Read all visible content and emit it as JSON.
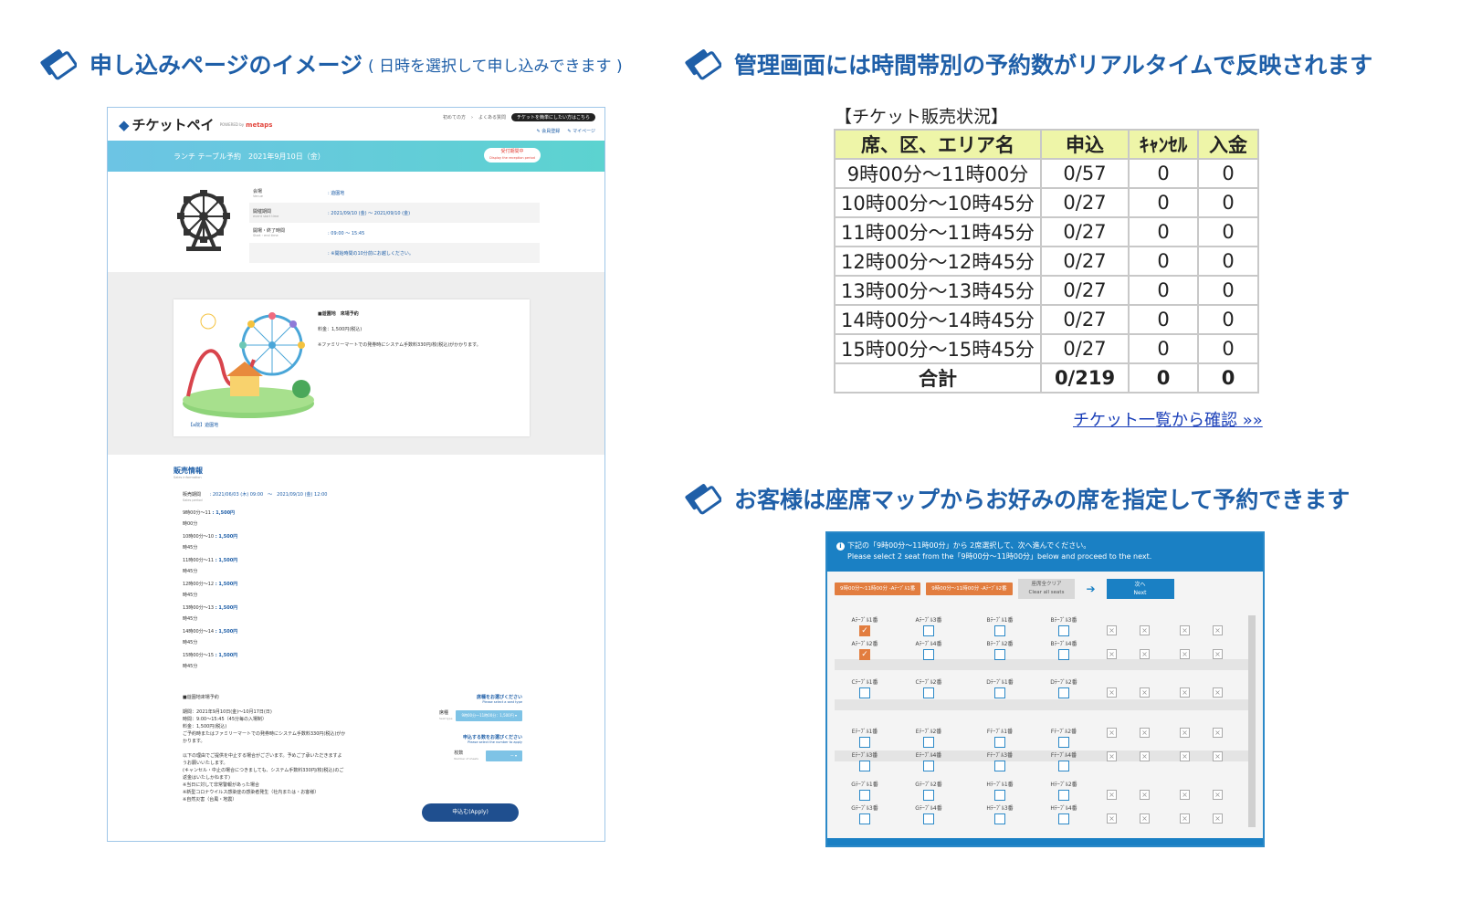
{
  "headings": {
    "left": {
      "main": "申し込みページのイメージ",
      "small": "( 日時を選択して申し込みできます )"
    },
    "right_top": "管理画面には時間帯別の予約数がリアルタイムで反映されます",
    "right_bottom": "お客様は座席マップからお好みの席を指定して予約できます"
  },
  "colors": {
    "heading": "#1f5fa8",
    "accent_orange": "#e27d3f",
    "accent_blue": "#1a80c4",
    "table_header": "#eef5a8"
  },
  "apply_page": {
    "logo": "チケットペイ",
    "logo_powered": "POWERED by",
    "logo_brand": "metaps",
    "links": [
      "初めての方",
      "よくある質問",
      "チケットを簡単にしたい方はこちら"
    ],
    "sublinks": [
      "会員登録",
      "マイページ"
    ],
    "event_title": "ランチ テーブル予約　2021年9月10日（金）",
    "status": "受付期間中",
    "status_en": "Display the reception period",
    "info": [
      {
        "label": "会場",
        "label_en": "Venue",
        "value": ": 遊園地"
      },
      {
        "label": "開催期間",
        "label_en": "event start time",
        "value": ": 2021/09/10 (金) 〜 2021/09/10 (金)"
      },
      {
        "label": "開場・終了時間",
        "label_en": "Start・end time",
        "value": ": 09:00 〜 15:45"
      },
      {
        "label": "",
        "label_en": "",
        "value": ": ※開始時間の10分前にお越しください。"
      }
    ],
    "card": {
      "title": "■遊園地　來場予約",
      "price": "料金：1,500円(税込)",
      "note": "※ファミリーマートでの発券時にシステム手数料330円/枚(税込)がかかります。",
      "tag": "【a院】遊園地"
    },
    "sales": {
      "title": "販売情報",
      "title_en": "Sales information",
      "period_label": "販売期間",
      "period_label_en": "Sales period",
      "period": ": 2021/06/03 (木) 09:00　〜　2021/09/10 (金) 12:00",
      "prices": [
        {
          "slot1": "9時00分〜11",
          "slot2": "時00分",
          "price": ": 1,500円"
        },
        {
          "slot1": "10時00分〜10",
          "slot2": "時45分",
          "price": ": 1,500円"
        },
        {
          "slot1": "11時00分〜11",
          "slot2": "時45分",
          "price": ": 1,500円"
        },
        {
          "slot1": "12時00分〜12",
          "slot2": "時45分",
          "price": ": 1,500円"
        },
        {
          "slot1": "13時00分〜13",
          "slot2": "時45分",
          "price": ": 1,500円"
        },
        {
          "slot1": "14時00分〜14",
          "slot2": "時45分",
          "price": ": 1,500円"
        },
        {
          "slot1": "15時00分〜15",
          "slot2": "時45分",
          "price": ": 1,500円"
        }
      ],
      "bottom_title": "■遊園地來場予約",
      "bottom_lines": [
        "期間：2021年9月10日(金)〜10月17日(日)",
        "時間：9:00〜15:45（45分毎の入場制）",
        "料金：1,500円(税込)",
        "ご予約時またはファミリーマートでの発券時にシステム手数料330円(税込)がか",
        "かります。",
        "",
        "以下の理由でご提供を中止する場合がございます。予めご了承いただきますよ",
        "うお願いいたします。",
        "(キャンセル・中止の場合につきましても、システム手数料330円/枚(税込)のご",
        "返金はいたしかねます)",
        "※当日に対して非常警報があった場合",
        "※新型コロナウイルス感染症の感染者発生（社内または・お客様）",
        "※自然災害（台風・地震）"
      ],
      "seat_type_label": "席種をお選びください",
      "seat_type_label_en": "Please select a seat type",
      "seat_type_field": "席種",
      "seat_type_field_en": "Seat type",
      "seat_type_value": "9時00分〜11時00分：1,500円",
      "qty_label": "申込する数をお選びください",
      "qty_label_en": "Please select the number to apply",
      "qty_field": "枚数",
      "qty_field_en": "Number of sheets",
      "qty_value": "ー",
      "apply": "申込む(Apply)"
    }
  },
  "sales_table": {
    "caption": "【チケット販売状況】",
    "headers": [
      "席、区、エリア名",
      "申込",
      "ｷｬﾝｾﾙ",
      "入金"
    ],
    "rows": [
      [
        "9時00分〜11時00分",
        "0/57",
        "0",
        "0"
      ],
      [
        "10時00分〜10時45分",
        "0/27",
        "0",
        "0"
      ],
      [
        "11時00分〜11時45分",
        "0/27",
        "0",
        "0"
      ],
      [
        "12時00分〜12時45分",
        "0/27",
        "0",
        "0"
      ],
      [
        "13時00分〜13時45分",
        "0/27",
        "0",
        "0"
      ],
      [
        "14時00分〜14時45分",
        "0/27",
        "0",
        "0"
      ],
      [
        "15時00分〜15時45分",
        "0/27",
        "0",
        "0"
      ]
    ],
    "total": [
      "合計",
      "0/219",
      "0",
      "0"
    ],
    "link": "チケット一覧から確認 »»"
  },
  "seat_map": {
    "instruction": "下記の「9時00分〜11時00分」から 2席選択して、次へ進んでください。",
    "instruction_en": "Please select 2 seat from the「9時00分〜11時00分」below and proceed to the next.",
    "selected": [
      "9時00分〜11時00分 -Aﾃｰﾌﾞﾙ1番",
      "9時00分〜11時00分 -Aﾃｰﾌﾞﾙ2番"
    ],
    "clear": "座席全クリア",
    "clear_en": "Clear all seats",
    "next": "次へ",
    "next_en": "Next",
    "seats": [
      {
        "label": "Aﾃｰﾌﾞﾙ1番",
        "checked": true
      },
      {
        "label": "Aﾃｰﾌﾞﾙ3番",
        "checked": false
      },
      {
        "label": "Bﾃｰﾌﾞﾙ1番",
        "checked": false
      },
      {
        "label": "Bﾃｰﾌﾞﾙ3番",
        "checked": false
      },
      {
        "label": "Aﾃｰﾌﾞﾙ2番",
        "checked": true
      },
      {
        "label": "Aﾃｰﾌﾞﾙ4番",
        "checked": false
      },
      {
        "label": "Bﾃｰﾌﾞﾙ2番",
        "checked": false
      },
      {
        "label": "Bﾃｰﾌﾞﾙ4番",
        "checked": false
      },
      {
        "label": "Cﾃｰﾌﾞﾙ1番",
        "checked": false
      },
      {
        "label": "Cﾃｰﾌﾞﾙ2番",
        "checked": false
      },
      {
        "label": "Dﾃｰﾌﾞﾙ1番",
        "checked": false
      },
      {
        "label": "Dﾃｰﾌﾞﾙ2番",
        "checked": false
      },
      {
        "label": "Eﾃｰﾌﾞﾙ1番",
        "checked": false
      },
      {
        "label": "Eﾃｰﾌﾞﾙ2番",
        "checked": false
      },
      {
        "label": "Fﾃｰﾌﾞﾙ1番",
        "checked": false
      },
      {
        "label": "Fﾃｰﾌﾞﾙ2番",
        "checked": false
      },
      {
        "label": "Eﾃｰﾌﾞﾙ3番",
        "checked": false
      },
      {
        "label": "Eﾃｰﾌﾞﾙ4番",
        "checked": false
      },
      {
        "label": "Fﾃｰﾌﾞﾙ3番",
        "checked": false
      },
      {
        "label": "Fﾃｰﾌﾞﾙ4番",
        "checked": false
      },
      {
        "label": "Gﾃｰﾌﾞﾙ1番",
        "checked": false
      },
      {
        "label": "Gﾃｰﾌﾞﾙ2番",
        "checked": false
      },
      {
        "label": "Hﾃｰﾌﾞﾙ1番",
        "checked": false
      },
      {
        "label": "Hﾃｰﾌﾞﾙ2番",
        "checked": false
      },
      {
        "label": "Gﾃｰﾌﾞﾙ3番",
        "checked": false
      },
      {
        "label": "Gﾃｰﾌﾞﾙ4番",
        "checked": false
      },
      {
        "label": "Hﾃｰﾌﾞﾙ3番",
        "checked": false
      },
      {
        "label": "Hﾃｰﾌﾞﾙ4番",
        "checked": false
      }
    ]
  }
}
